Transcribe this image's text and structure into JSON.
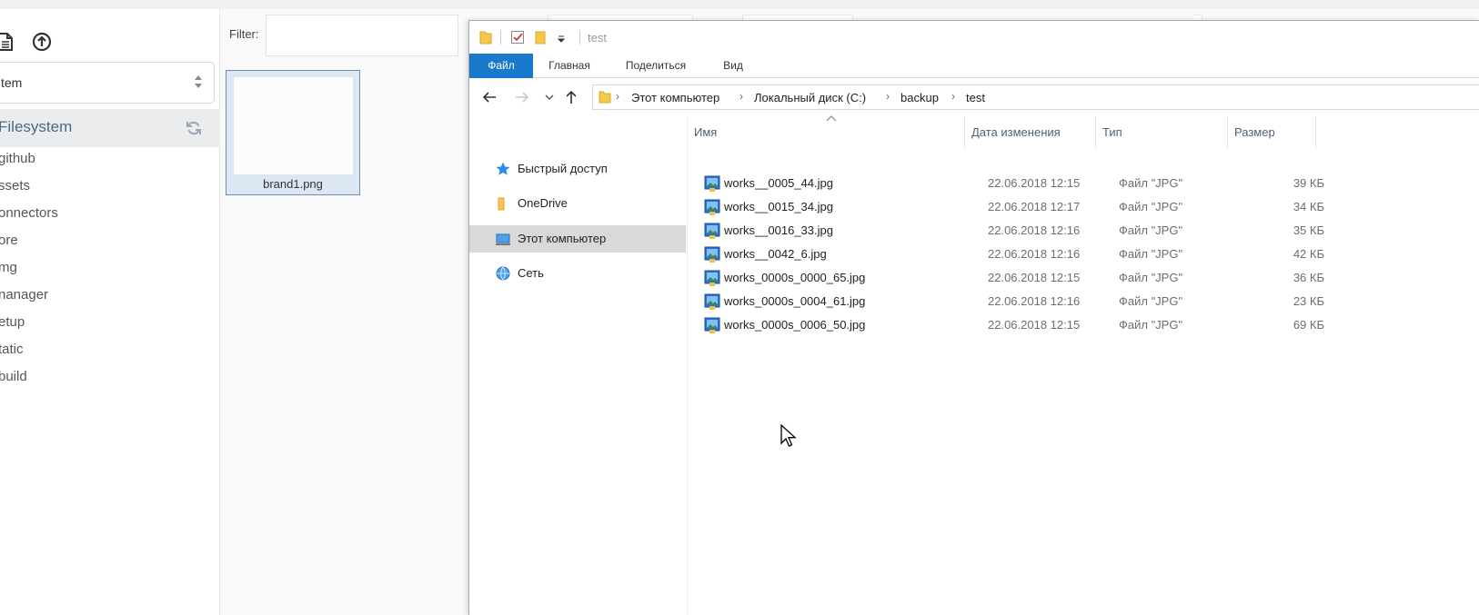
{
  "app": {
    "source_select": {
      "value": "tem"
    },
    "tree": {
      "root_label": "Filesystem",
      "items": [
        "github",
        "ssets",
        "onnectors",
        "ore",
        "mg",
        "nanager",
        "etup",
        "tatic",
        "build"
      ]
    },
    "filter_label": "Filter:",
    "thumbnail": {
      "name": "brand1.png"
    }
  },
  "explorer": {
    "window_title": "test",
    "ribbon_tabs": [
      "Файл",
      "Главная",
      "Поделиться",
      "Вид"
    ],
    "breadcrumb": [
      "Этот компьютер",
      "Локальный диск (C:)",
      "backup",
      "test"
    ],
    "nav_pane": [
      "Быстрый доступ",
      "OneDrive",
      "Этот компьютер",
      "Сеть"
    ],
    "columns": [
      "Имя",
      "Дата изменения",
      "Тип",
      "Размер"
    ],
    "files": [
      {
        "name": "works__0005_44.jpg",
        "date": "22.06.2018 12:15",
        "type": "Файл \"JPG\"",
        "size": "39 КБ"
      },
      {
        "name": "works__0015_34.jpg",
        "date": "22.06.2018 12:17",
        "type": "Файл \"JPG\"",
        "size": "34 КБ"
      },
      {
        "name": "works__0016_33.jpg",
        "date": "22.06.2018 12:16",
        "type": "Файл \"JPG\"",
        "size": "35 КБ"
      },
      {
        "name": "works__0042_6.jpg",
        "date": "22.06.2018 12:16",
        "type": "Файл \"JPG\"",
        "size": "42 КБ"
      },
      {
        "name": "works_0000s_0000_65.jpg",
        "date": "22.06.2018 12:15",
        "type": "Файл \"JPG\"",
        "size": "36 КБ"
      },
      {
        "name": "works_0000s_0004_61.jpg",
        "date": "22.06.2018 12:16",
        "type": "Файл \"JPG\"",
        "size": "23 КБ"
      },
      {
        "name": "works_0000s_0006_50.jpg",
        "date": "22.06.2018 12:15",
        "type": "Файл \"JPG\"",
        "size": "69 КБ"
      }
    ]
  },
  "colors": {
    "ribbon_file_tab": "#1979ca",
    "selected_nav": "#d9d9d9",
    "tree_root_text": "#4a6b86",
    "thumb_selected_bg": "#dde7f3"
  },
  "icons": {
    "app_toolbar": [
      "file-icon",
      "upload-icon"
    ],
    "tree_root": "refresh-icon",
    "nav_pane": [
      "star-icon",
      "folder-icon",
      "computer-icon",
      "network-icon"
    ],
    "file": "image-file-icon"
  }
}
